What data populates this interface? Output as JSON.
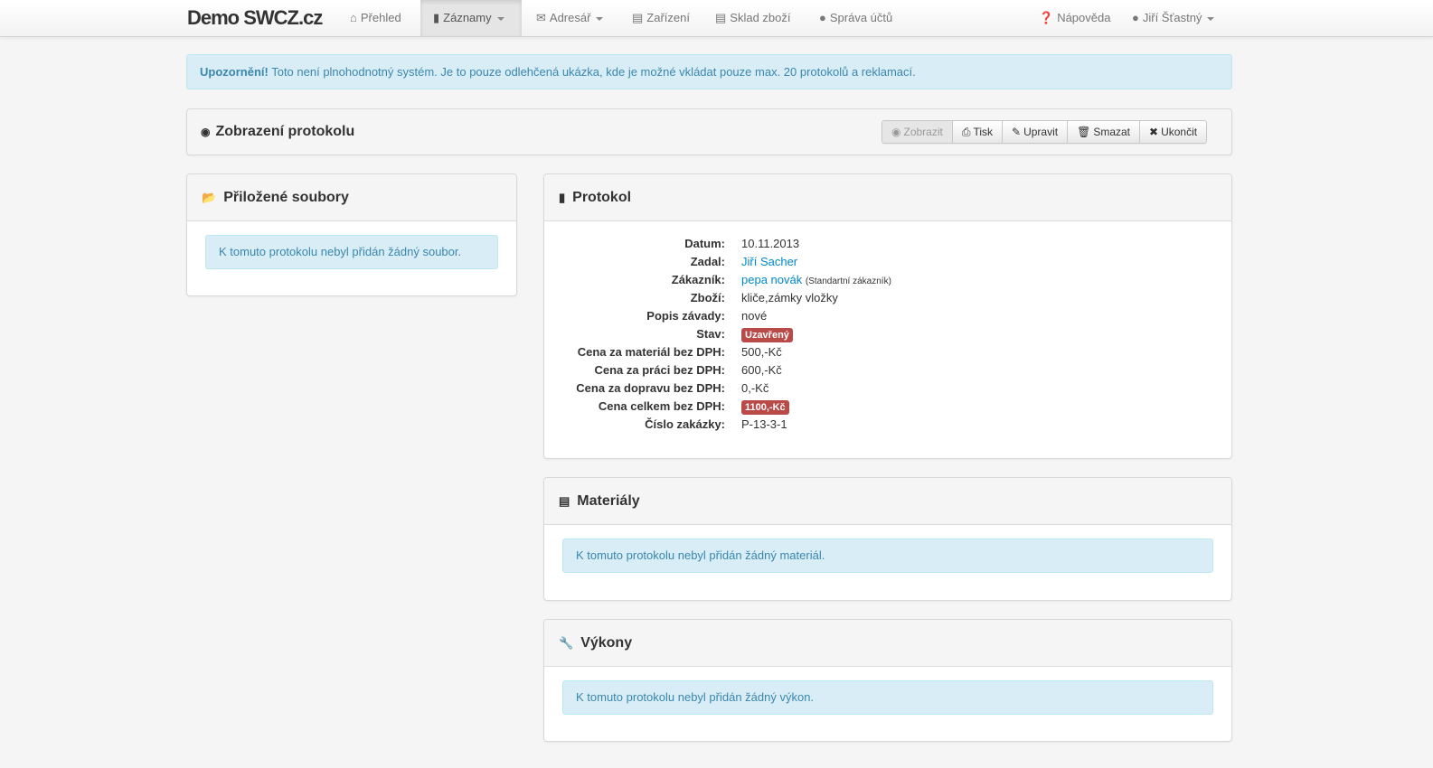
{
  "navbar": {
    "brand": "Demo SWCZ.cz",
    "items": [
      {
        "label": "Přehled",
        "icon": "home-icon"
      },
      {
        "label": "Záznamy",
        "icon": "file-icon"
      },
      {
        "label": "Adresář",
        "icon": "envelope-icon"
      },
      {
        "label": "Zařízení",
        "icon": "hdd-icon"
      },
      {
        "label": "Sklad zboží",
        "icon": "inbox-icon"
      },
      {
        "label": "Správa účtů",
        "icon": "user-icon"
      }
    ],
    "help": "Nápověda",
    "user": "Jiří Šťastný"
  },
  "notice": {
    "strong": "Upozornění!",
    "text": "Toto není plnohodnotný systém. Je to pouze odlehčená ukázka, kde je možné vkládat pouze max. 20 protokolů a reklamací."
  },
  "header": {
    "title": "Zobrazení protokolu",
    "buttons": {
      "view": "Zobrazit",
      "print": "Tisk",
      "edit": "Upravit",
      "delete": "Smazat",
      "close": "Ukončit"
    }
  },
  "files": {
    "title": "Přiložené soubory",
    "empty": "K tomuto protokolu nebyl přidán žádný soubor."
  },
  "protocol": {
    "title": "Protokol",
    "fields": {
      "date_label": "Datum:",
      "date": "10.11.2013",
      "entered_label": "Zadal:",
      "entered": "Jiří Sacher",
      "customer_label": "Zákazník:",
      "customer": "pepa novák",
      "customer_type": "(Standartní zákazník)",
      "goods_label": "Zboží:",
      "goods": "kliče,zámky vložky",
      "fault_label": "Popis závady:",
      "fault": "nové",
      "state_label": "Stav:",
      "state": "Uzavřený",
      "material_label": "Cena za materiál bez DPH:",
      "material": "500,-Kč",
      "work_label": "Cena za práci bez DPH:",
      "work": "600,-Kč",
      "transport_label": "Cena za dopravu bez DPH:",
      "transport": "0,-Kč",
      "total_label": "Cena celkem bez DPH:",
      "total": "1100,-Kč",
      "order_label": "Číslo zakázky:",
      "order": "P-13-3-1"
    }
  },
  "materials": {
    "title": "Materiály",
    "empty": "K tomuto protokolu nebyl přidán žádný materiál."
  },
  "works": {
    "title": "Výkony",
    "empty": "K tomuto protokolu nebyl přidán žádný výkon."
  },
  "colors": {
    "accent": "#0088cc",
    "alert_bg": "#d9edf7",
    "alert_text": "#3a87ad",
    "label_red": "#b94a48"
  }
}
